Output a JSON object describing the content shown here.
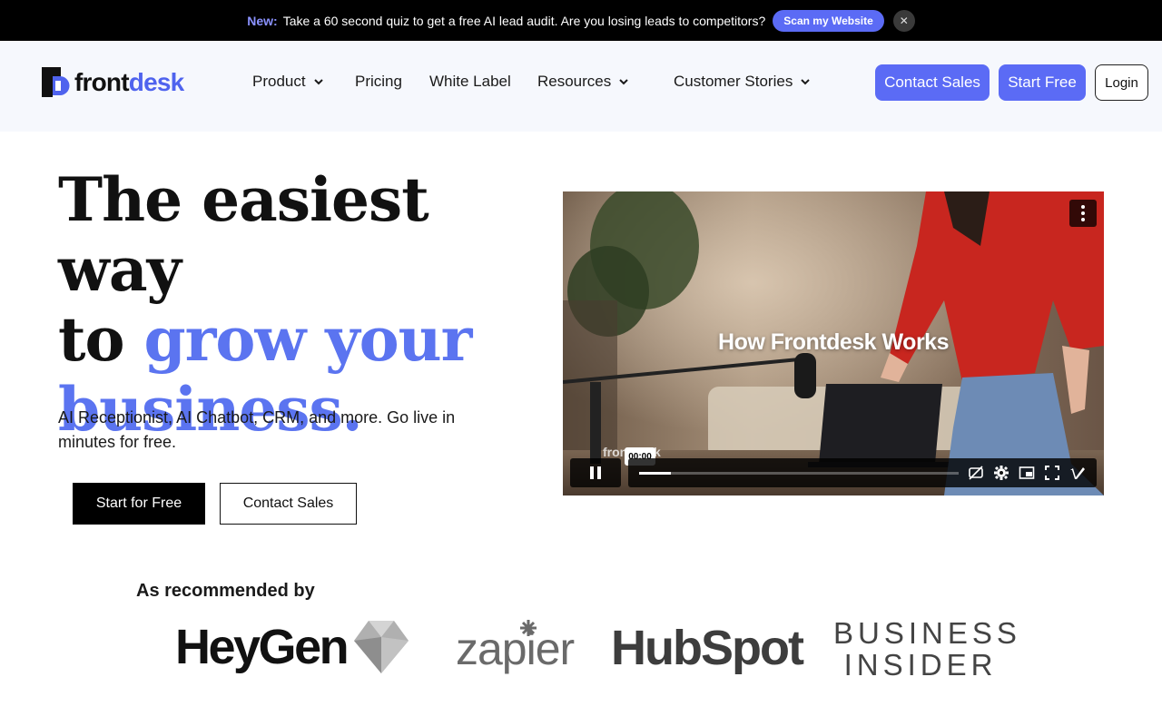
{
  "announcement": {
    "badge": "New:",
    "message": "Take a 60 second quiz to get a free AI lead audit. Are you losing leads to competitors?",
    "cta": "Scan my Website",
    "close_icon": "close-icon"
  },
  "nav": {
    "logo_front": "front",
    "logo_desk": "desk",
    "items": [
      {
        "label": "Product",
        "dropdown": true
      },
      {
        "label": "Pricing",
        "dropdown": false
      },
      {
        "label": "White Label",
        "dropdown": false
      },
      {
        "label": "Resources",
        "dropdown": true
      },
      {
        "label": "Customer Stories",
        "dropdown": true
      }
    ],
    "contact_sales": "Contact Sales",
    "start_free": "Start Free",
    "login": "Login"
  },
  "hero": {
    "title_line1": "The easiest way",
    "title_to": "to",
    "title_accent1": "grow your",
    "title_accent2": "business.",
    "subtitle": "AI Receptionist, AI Chatbot, CRM, and more. Go live in minutes for free.",
    "primary_cta": "Start for Free",
    "secondary_cta": "Contact Sales"
  },
  "video": {
    "title": "How  Frontdesk Works",
    "watermark": "frontdesk",
    "time": "00:00",
    "progress_fraction": 0.1
  },
  "recommended": {
    "heading": "As recommended by",
    "logos": [
      "HeyGen",
      "zapier",
      "HubSpot",
      "BUSINESS",
      "INSIDER"
    ]
  },
  "colors": {
    "accent": "#5b6bf5",
    "hero_accent": "#5b74f0",
    "nav_bg": "#f6f8fd"
  }
}
